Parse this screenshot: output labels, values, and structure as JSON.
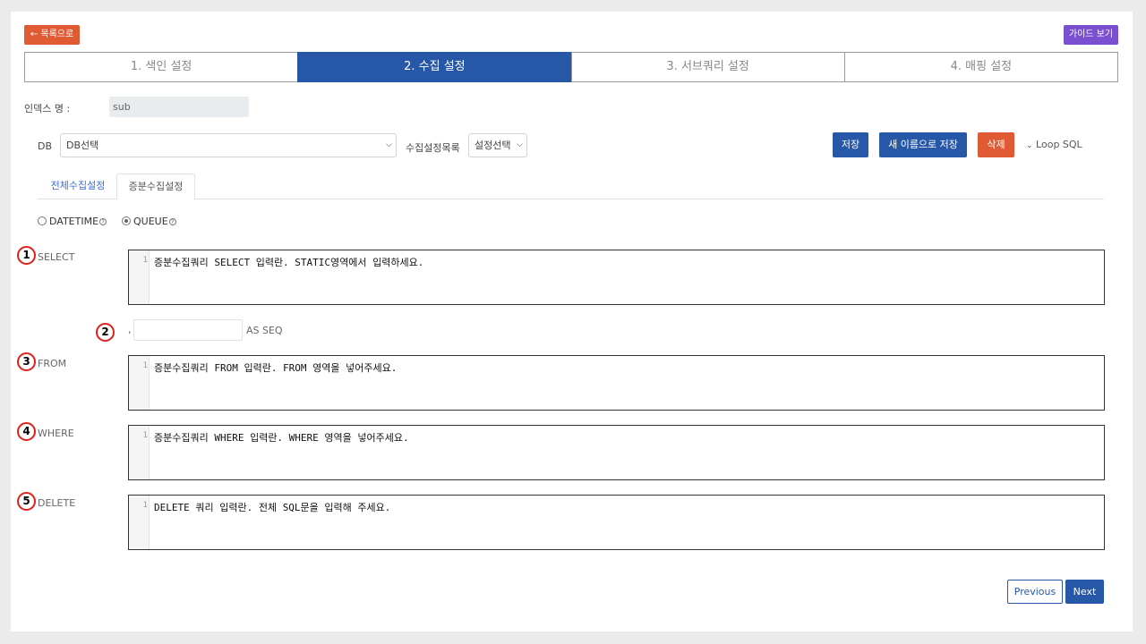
{
  "header": {
    "back_label": "← 목록으로",
    "guide_label": "가이드 보기"
  },
  "steps": [
    {
      "label": "1. 색인 설정",
      "active": false
    },
    {
      "label": "2. 수집 설정",
      "active": true
    },
    {
      "label": "3. 서브쿼리 설정",
      "active": false
    },
    {
      "label": "4. 매핑 설정",
      "active": false
    }
  ],
  "index": {
    "label": "인덱스 명 :",
    "value": "sub"
  },
  "db_row": {
    "db_label": "DB",
    "db_select": "DB선택",
    "collect_label": "수집설정목록",
    "collect_select": "설정선택",
    "save_label": "저장",
    "save_as_label": "새 이름으로 저장",
    "delete_label": "삭제",
    "loop_label": "Loop SQL"
  },
  "tabs": [
    {
      "label": "전체수집설정",
      "active": false
    },
    {
      "label": "증분수집설정",
      "active": true
    }
  ],
  "radios": [
    {
      "label": "DATETIME",
      "checked": false
    },
    {
      "label": "QUEUE",
      "checked": true
    }
  ],
  "markers": [
    "1",
    "2",
    "3",
    "4",
    "5"
  ],
  "fields": {
    "select": {
      "label": "SELECT",
      "line": "1",
      "code": "증분수집쿼리 SELECT 입력란. STATIC영역에서 입력하세요."
    },
    "seq": {
      "prefix": ",",
      "suffix": "AS SEQ",
      "value": ""
    },
    "from": {
      "label": "FROM",
      "line": "1",
      "code": "증분수집쿼리 FROM 입력란. FROM 영역을 넣어주세요."
    },
    "where": {
      "label": "WHERE",
      "line": "1",
      "code": "증분수집쿼리 WHERE 입력란. WHERE 영역을 넣어주세요."
    },
    "delete": {
      "label": "DELETE",
      "line": "1",
      "code": "DELETE 쿼리 입력란. 전체 SQL문을 입력해 주세요."
    }
  },
  "footer": {
    "previous_label": "Previous",
    "next_label": "Next"
  },
  "colors": {
    "primary": "#2757a7",
    "danger": "#e05a33",
    "guide": "#7b4fd1",
    "marker": "#e0201a"
  }
}
